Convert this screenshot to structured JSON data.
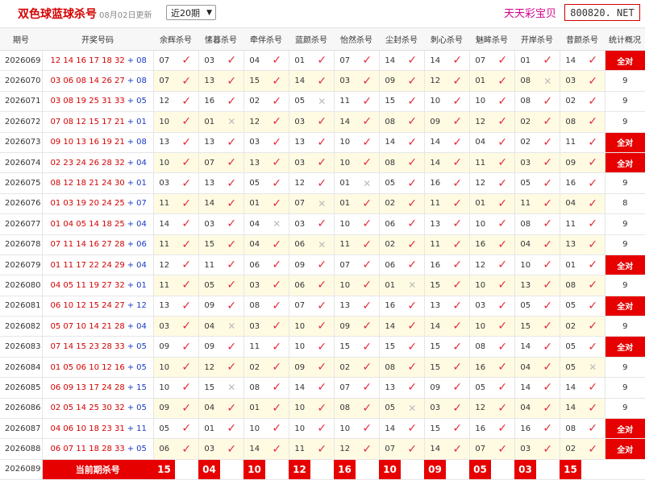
{
  "header": {
    "title": "双色球蓝球杀号",
    "updated": "08月02日更新",
    "select_value": "近20期",
    "brand": "天天彩宝贝",
    "site": "800820. NET"
  },
  "columns": [
    "期号",
    "开奖号码",
    "余辉杀号",
    "愫暮杀号",
    "牵伴杀号",
    "蓝颜杀号",
    "怡然杀号",
    "尘封杀号",
    "刺心杀号",
    "魅眸杀号",
    "开岸杀号",
    "昔颜杀号",
    "统计概况"
  ],
  "colors": {
    "accent": "#e60000",
    "red_ball": "#d40000",
    "blue_ball": "#1a3bc4",
    "check": "#e32b3b"
  },
  "rows": [
    {
      "issue": "2026069",
      "red": "12 14 16 17 18 32",
      "blue": "08",
      "kills": [
        {
          "v": "07",
          "ok": true
        },
        {
          "v": "03",
          "ok": true
        },
        {
          "v": "04",
          "ok": true
        },
        {
          "v": "01",
          "ok": true
        },
        {
          "v": "07",
          "ok": true
        },
        {
          "v": "14",
          "ok": true
        },
        {
          "v": "14",
          "ok": true
        },
        {
          "v": "07",
          "ok": true
        },
        {
          "v": "01",
          "ok": true
        },
        {
          "v": "14",
          "ok": true
        }
      ],
      "stat": "全对"
    },
    {
      "issue": "2026070",
      "red": "03 06 08 14 26 27",
      "blue": "08",
      "kills": [
        {
          "v": "07",
          "ok": true
        },
        {
          "v": "13",
          "ok": true
        },
        {
          "v": "15",
          "ok": true
        },
        {
          "v": "14",
          "ok": true
        },
        {
          "v": "03",
          "ok": true
        },
        {
          "v": "09",
          "ok": true
        },
        {
          "v": "12",
          "ok": true
        },
        {
          "v": "01",
          "ok": true
        },
        {
          "v": "08",
          "ok": false
        },
        {
          "v": "03",
          "ok": true
        }
      ],
      "stat": "9"
    },
    {
      "issue": "2026071",
      "red": "03 08 19 25 31 33",
      "blue": "05",
      "kills": [
        {
          "v": "12",
          "ok": true
        },
        {
          "v": "16",
          "ok": true
        },
        {
          "v": "02",
          "ok": true
        },
        {
          "v": "05",
          "ok": false
        },
        {
          "v": "11",
          "ok": true
        },
        {
          "v": "15",
          "ok": true
        },
        {
          "v": "10",
          "ok": true
        },
        {
          "v": "10",
          "ok": true
        },
        {
          "v": "08",
          "ok": true
        },
        {
          "v": "02",
          "ok": true
        }
      ],
      "stat": "9"
    },
    {
      "issue": "2026072",
      "red": "07 08 12 15 17 21",
      "blue": "01",
      "kills": [
        {
          "v": "10",
          "ok": true
        },
        {
          "v": "01",
          "ok": false
        },
        {
          "v": "12",
          "ok": true
        },
        {
          "v": "03",
          "ok": true
        },
        {
          "v": "14",
          "ok": true
        },
        {
          "v": "08",
          "ok": true
        },
        {
          "v": "09",
          "ok": true
        },
        {
          "v": "12",
          "ok": true
        },
        {
          "v": "02",
          "ok": true
        },
        {
          "v": "08",
          "ok": true
        }
      ],
      "stat": "9"
    },
    {
      "issue": "2026073",
      "red": "09 10 13 16 19 21",
      "blue": "08",
      "kills": [
        {
          "v": "13",
          "ok": true
        },
        {
          "v": "13",
          "ok": true
        },
        {
          "v": "03",
          "ok": true
        },
        {
          "v": "13",
          "ok": true
        },
        {
          "v": "10",
          "ok": true
        },
        {
          "v": "14",
          "ok": true
        },
        {
          "v": "14",
          "ok": true
        },
        {
          "v": "04",
          "ok": true
        },
        {
          "v": "02",
          "ok": true
        },
        {
          "v": "11",
          "ok": true
        }
      ],
      "stat": "全对"
    },
    {
      "issue": "2026074",
      "red": "02 23 24 26 28 32",
      "blue": "04",
      "kills": [
        {
          "v": "10",
          "ok": true
        },
        {
          "v": "07",
          "ok": true
        },
        {
          "v": "13",
          "ok": true
        },
        {
          "v": "03",
          "ok": true
        },
        {
          "v": "10",
          "ok": true
        },
        {
          "v": "08",
          "ok": true
        },
        {
          "v": "14",
          "ok": true
        },
        {
          "v": "11",
          "ok": true
        },
        {
          "v": "03",
          "ok": true
        },
        {
          "v": "09",
          "ok": true
        }
      ],
      "stat": "全对"
    },
    {
      "issue": "2026075",
      "red": "08 12 18 21 24 30",
      "blue": "01",
      "kills": [
        {
          "v": "03",
          "ok": true
        },
        {
          "v": "13",
          "ok": true
        },
        {
          "v": "05",
          "ok": true
        },
        {
          "v": "12",
          "ok": true
        },
        {
          "v": "01",
          "ok": false
        },
        {
          "v": "05",
          "ok": true
        },
        {
          "v": "16",
          "ok": true
        },
        {
          "v": "12",
          "ok": true
        },
        {
          "v": "05",
          "ok": true
        },
        {
          "v": "16",
          "ok": true
        }
      ],
      "stat": "9"
    },
    {
      "issue": "2026076",
      "red": "01 03 19 20 24 25",
      "blue": "07",
      "kills": [
        {
          "v": "11",
          "ok": true
        },
        {
          "v": "14",
          "ok": true
        },
        {
          "v": "01",
          "ok": true
        },
        {
          "v": "07",
          "ok": false
        },
        {
          "v": "01",
          "ok": true
        },
        {
          "v": "02",
          "ok": true
        },
        {
          "v": "11",
          "ok": true
        },
        {
          "v": "01",
          "ok": true
        },
        {
          "v": "11",
          "ok": true
        },
        {
          "v": "04",
          "ok": true
        }
      ],
      "stat": "8"
    },
    {
      "issue": "2026077",
      "red": "01 04 05 14 18 25",
      "blue": "04",
      "kills": [
        {
          "v": "14",
          "ok": true
        },
        {
          "v": "03",
          "ok": true
        },
        {
          "v": "04",
          "ok": false
        },
        {
          "v": "03",
          "ok": true
        },
        {
          "v": "10",
          "ok": true
        },
        {
          "v": "06",
          "ok": true
        },
        {
          "v": "13",
          "ok": true
        },
        {
          "v": "10",
          "ok": true
        },
        {
          "v": "08",
          "ok": true
        },
        {
          "v": "11",
          "ok": true
        }
      ],
      "stat": "9"
    },
    {
      "issue": "2026078",
      "red": "07 11 14 16 27 28",
      "blue": "06",
      "kills": [
        {
          "v": "11",
          "ok": true
        },
        {
          "v": "15",
          "ok": true
        },
        {
          "v": "04",
          "ok": true
        },
        {
          "v": "06",
          "ok": false
        },
        {
          "v": "11",
          "ok": true
        },
        {
          "v": "02",
          "ok": true
        },
        {
          "v": "11",
          "ok": true
        },
        {
          "v": "16",
          "ok": true
        },
        {
          "v": "04",
          "ok": true
        },
        {
          "v": "13",
          "ok": true
        }
      ],
      "stat": "9"
    },
    {
      "issue": "2026079",
      "red": "01 11 17 22 24 29",
      "blue": "04",
      "kills": [
        {
          "v": "12",
          "ok": true
        },
        {
          "v": "11",
          "ok": true
        },
        {
          "v": "06",
          "ok": true
        },
        {
          "v": "09",
          "ok": true
        },
        {
          "v": "07",
          "ok": true
        },
        {
          "v": "06",
          "ok": true
        },
        {
          "v": "16",
          "ok": true
        },
        {
          "v": "12",
          "ok": true
        },
        {
          "v": "10",
          "ok": true
        },
        {
          "v": "01",
          "ok": true
        }
      ],
      "stat": "全对"
    },
    {
      "issue": "2026080",
      "red": "04 05 11 19 27 32",
      "blue": "01",
      "kills": [
        {
          "v": "11",
          "ok": true
        },
        {
          "v": "05",
          "ok": true
        },
        {
          "v": "03",
          "ok": true
        },
        {
          "v": "06",
          "ok": true
        },
        {
          "v": "10",
          "ok": true
        },
        {
          "v": "01",
          "ok": false
        },
        {
          "v": "15",
          "ok": true
        },
        {
          "v": "10",
          "ok": true
        },
        {
          "v": "13",
          "ok": true
        },
        {
          "v": "08",
          "ok": true
        }
      ],
      "stat": "9"
    },
    {
      "issue": "2026081",
      "red": "06 10 12 15 24 27",
      "blue": "12",
      "kills": [
        {
          "v": "13",
          "ok": true
        },
        {
          "v": "09",
          "ok": true
        },
        {
          "v": "08",
          "ok": true
        },
        {
          "v": "07",
          "ok": true
        },
        {
          "v": "13",
          "ok": true
        },
        {
          "v": "16",
          "ok": true
        },
        {
          "v": "13",
          "ok": true
        },
        {
          "v": "03",
          "ok": true
        },
        {
          "v": "05",
          "ok": true
        },
        {
          "v": "05",
          "ok": true
        }
      ],
      "stat": "全对"
    },
    {
      "issue": "2026082",
      "red": "05 07 10 14 21 28",
      "blue": "04",
      "kills": [
        {
          "v": "03",
          "ok": true
        },
        {
          "v": "04",
          "ok": false
        },
        {
          "v": "03",
          "ok": true
        },
        {
          "v": "10",
          "ok": true
        },
        {
          "v": "09",
          "ok": true
        },
        {
          "v": "14",
          "ok": true
        },
        {
          "v": "14",
          "ok": true
        },
        {
          "v": "10",
          "ok": true
        },
        {
          "v": "15",
          "ok": true
        },
        {
          "v": "02",
          "ok": true
        }
      ],
      "stat": "9"
    },
    {
      "issue": "2026083",
      "red": "07 14 15 23 28 33",
      "blue": "05",
      "kills": [
        {
          "v": "09",
          "ok": true
        },
        {
          "v": "09",
          "ok": true
        },
        {
          "v": "11",
          "ok": true
        },
        {
          "v": "10",
          "ok": true
        },
        {
          "v": "15",
          "ok": true
        },
        {
          "v": "15",
          "ok": true
        },
        {
          "v": "15",
          "ok": true
        },
        {
          "v": "08",
          "ok": true
        },
        {
          "v": "14",
          "ok": true
        },
        {
          "v": "05",
          "ok": true
        }
      ],
      "stat": "全对"
    },
    {
      "issue": "2026084",
      "red": "01 05 06 10 12 16",
      "blue": "05",
      "kills": [
        {
          "v": "10",
          "ok": true
        },
        {
          "v": "12",
          "ok": true
        },
        {
          "v": "02",
          "ok": true
        },
        {
          "v": "09",
          "ok": true
        },
        {
          "v": "02",
          "ok": true
        },
        {
          "v": "08",
          "ok": true
        },
        {
          "v": "15",
          "ok": true
        },
        {
          "v": "16",
          "ok": true
        },
        {
          "v": "04",
          "ok": true
        },
        {
          "v": "05",
          "ok": false
        }
      ],
      "stat": "9"
    },
    {
      "issue": "2026085",
      "red": "06 09 13 17 24 28",
      "blue": "15",
      "kills": [
        {
          "v": "10",
          "ok": true
        },
        {
          "v": "15",
          "ok": false
        },
        {
          "v": "08",
          "ok": true
        },
        {
          "v": "14",
          "ok": true
        },
        {
          "v": "07",
          "ok": true
        },
        {
          "v": "13",
          "ok": true
        },
        {
          "v": "09",
          "ok": true
        },
        {
          "v": "05",
          "ok": true
        },
        {
          "v": "14",
          "ok": true
        },
        {
          "v": "14",
          "ok": true
        }
      ],
      "stat": "9"
    },
    {
      "issue": "2026086",
      "red": "02 05 14 25 30 32",
      "blue": "05",
      "kills": [
        {
          "v": "09",
          "ok": true
        },
        {
          "v": "04",
          "ok": true
        },
        {
          "v": "01",
          "ok": true
        },
        {
          "v": "10",
          "ok": true
        },
        {
          "v": "08",
          "ok": true
        },
        {
          "v": "05",
          "ok": false
        },
        {
          "v": "03",
          "ok": true
        },
        {
          "v": "12",
          "ok": true
        },
        {
          "v": "04",
          "ok": true
        },
        {
          "v": "14",
          "ok": true
        }
      ],
      "stat": "9"
    },
    {
      "issue": "2026087",
      "red": "04 06 10 18 23 31",
      "blue": "11",
      "kills": [
        {
          "v": "05",
          "ok": true
        },
        {
          "v": "01",
          "ok": true
        },
        {
          "v": "10",
          "ok": true
        },
        {
          "v": "10",
          "ok": true
        },
        {
          "v": "10",
          "ok": true
        },
        {
          "v": "14",
          "ok": true
        },
        {
          "v": "15",
          "ok": true
        },
        {
          "v": "16",
          "ok": true
        },
        {
          "v": "16",
          "ok": true
        },
        {
          "v": "08",
          "ok": true
        }
      ],
      "stat": "全对"
    },
    {
      "issue": "2026088",
      "red": "06 07 11 18 28 33",
      "blue": "05",
      "kills": [
        {
          "v": "06",
          "ok": true
        },
        {
          "v": "03",
          "ok": true
        },
        {
          "v": "14",
          "ok": true
        },
        {
          "v": "11",
          "ok": true
        },
        {
          "v": "12",
          "ok": true
        },
        {
          "v": "07",
          "ok": true
        },
        {
          "v": "14",
          "ok": true
        },
        {
          "v": "07",
          "ok": true
        },
        {
          "v": "03",
          "ok": true
        },
        {
          "v": "02",
          "ok": true
        }
      ],
      "stat": "全对"
    }
  ],
  "current": {
    "issue": "2026089",
    "label": "当前期杀号",
    "kills": [
      "15",
      "04",
      "10",
      "12",
      "16",
      "10",
      "09",
      "05",
      "03",
      "15"
    ]
  },
  "symbols": {
    "check": "✓",
    "cross": "✕",
    "plus": "+"
  }
}
